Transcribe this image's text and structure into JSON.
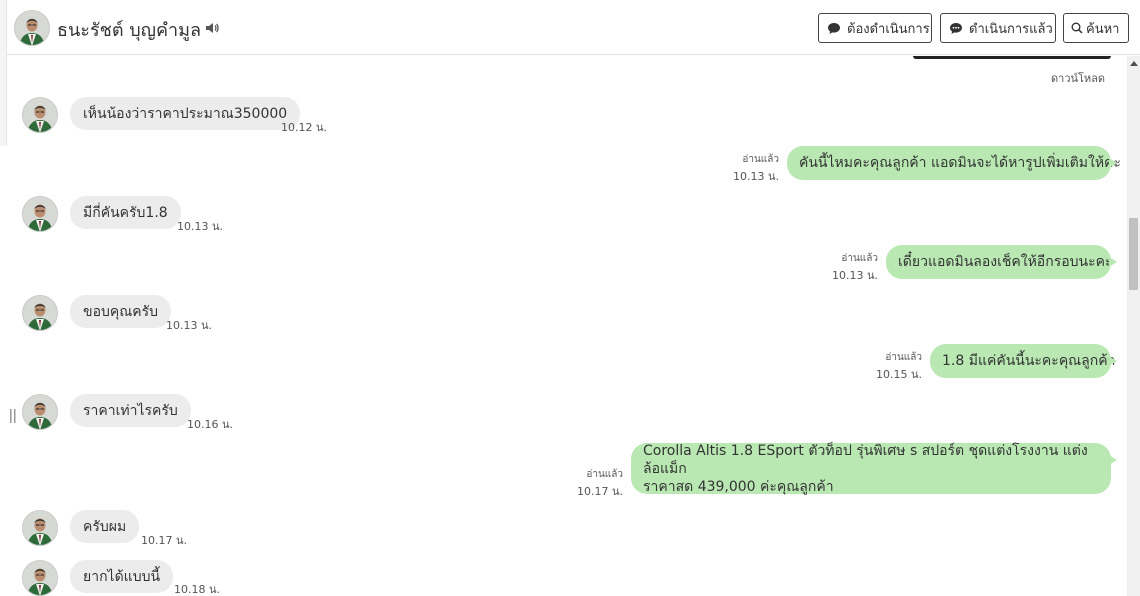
{
  "header": {
    "contact_name": "ธนะรัชต์ บุญคำมูล",
    "buttons": {
      "pending": "ต้องดำเนินการ",
      "done": "ดำเนินการแล้ว",
      "search": "ค้นหา"
    }
  },
  "download_label": "ดาวน์โหลด",
  "messages": [
    {
      "direction": "in",
      "text": "เห็นน้องว่าราคาประมาณ350000",
      "time": "10.12 น."
    },
    {
      "direction": "out",
      "text": "คันนี้ไหมคะคุณลูกค้า แอดมินจะได้หารูปเพิ่มเติมให้คะ",
      "read": "อ่านแล้ว",
      "time": "10.13 น."
    },
    {
      "direction": "in",
      "text": "มีกี่คันครับ1.8",
      "time": "10.13 น."
    },
    {
      "direction": "out",
      "text": "เดี๋ยวแอดมินลองเช็คให้อีกรอบนะคะ",
      "read": "อ่านแล้ว",
      "time": "10.13 น."
    },
    {
      "direction": "in",
      "text": "ขอบคุณครับ",
      "time": "10.13 น."
    },
    {
      "direction": "out",
      "text": "1.8 มีแค่คันนี้นะคะคุณลูกค้า",
      "read": "อ่านแล้ว",
      "time": "10.15 น."
    },
    {
      "direction": "in",
      "text": "ราคาเท่าไรครับ",
      "time": "10.16 น."
    },
    {
      "direction": "out",
      "lines": [
        "Corolla Altis 1.8 ESport ตัวท็อป รุ่นพิเศษ s สปอร์ต ชุดแต่งโรงงาน แต่งล้อแม็ก",
        "ราคาสด 439,000 ค่ะคุณลูกค้า"
      ],
      "read": "อ่านแล้ว",
      "time": "10.17 น."
    },
    {
      "direction": "in",
      "text": "ครับผม",
      "time": "10.17 น."
    },
    {
      "direction": "in",
      "text": "ยากได้แบบนี้",
      "time": "10.18 น."
    }
  ]
}
